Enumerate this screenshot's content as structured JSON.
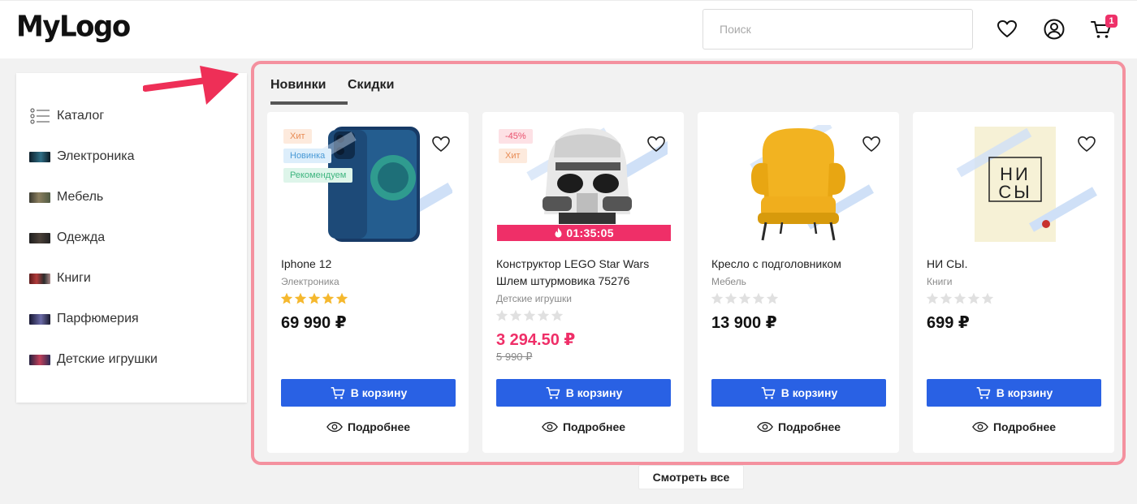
{
  "header": {
    "logo": "MyLogo",
    "search_placeholder": "Поиск",
    "cart_count": "1"
  },
  "sidebar": {
    "items": [
      {
        "label": "Каталог",
        "icon": "list-icon"
      },
      {
        "label": "Электроника",
        "icon": "electronics-thumb"
      },
      {
        "label": "Мебель",
        "icon": "furniture-thumb"
      },
      {
        "label": "Одежда",
        "icon": "clothing-thumb"
      },
      {
        "label": "Книги",
        "icon": "books-thumb"
      },
      {
        "label": "Парфюмерия",
        "icon": "perfume-thumb"
      },
      {
        "label": "Детские игрушки",
        "icon": "toys-thumb"
      }
    ]
  },
  "tabs": [
    {
      "label": "Новинки",
      "active": true
    },
    {
      "label": "Скидки",
      "active": false
    }
  ],
  "products": [
    {
      "title": "Iphone 12",
      "category": "Электроника",
      "rating": 5,
      "price": "69 990 ₽",
      "badges": [
        "Хит",
        "Новинка",
        "Рекомендуем"
      ]
    },
    {
      "title": "Конструктор LEGO Star Wars Шлем штурмовика 75276",
      "category": "Детские игрушки",
      "rating": 0,
      "price": "3 294.50 ₽",
      "old_price": "5 990 ₽",
      "badges": [
        "-45%",
        "Хит"
      ],
      "timer": "01:35:05"
    },
    {
      "title": "Кресло с подголовником",
      "category": "Мебель",
      "rating": 0,
      "price": "13 900 ₽",
      "badges": []
    },
    {
      "title": "НИ СЫ.",
      "category": "Книги",
      "rating": 0,
      "price": "699 ₽",
      "badges": [],
      "book_cover_text": "НИ СЫ"
    }
  ],
  "buttons": {
    "add_to_cart": "В корзину",
    "details": "Подробнее",
    "see_all": "Смотреть все"
  },
  "colors": {
    "accent": "#2961e4",
    "sale": "#ef2f68",
    "frame": "#f4919f",
    "star_on": "#f5b82e",
    "star_off": "#e0e0e0"
  }
}
